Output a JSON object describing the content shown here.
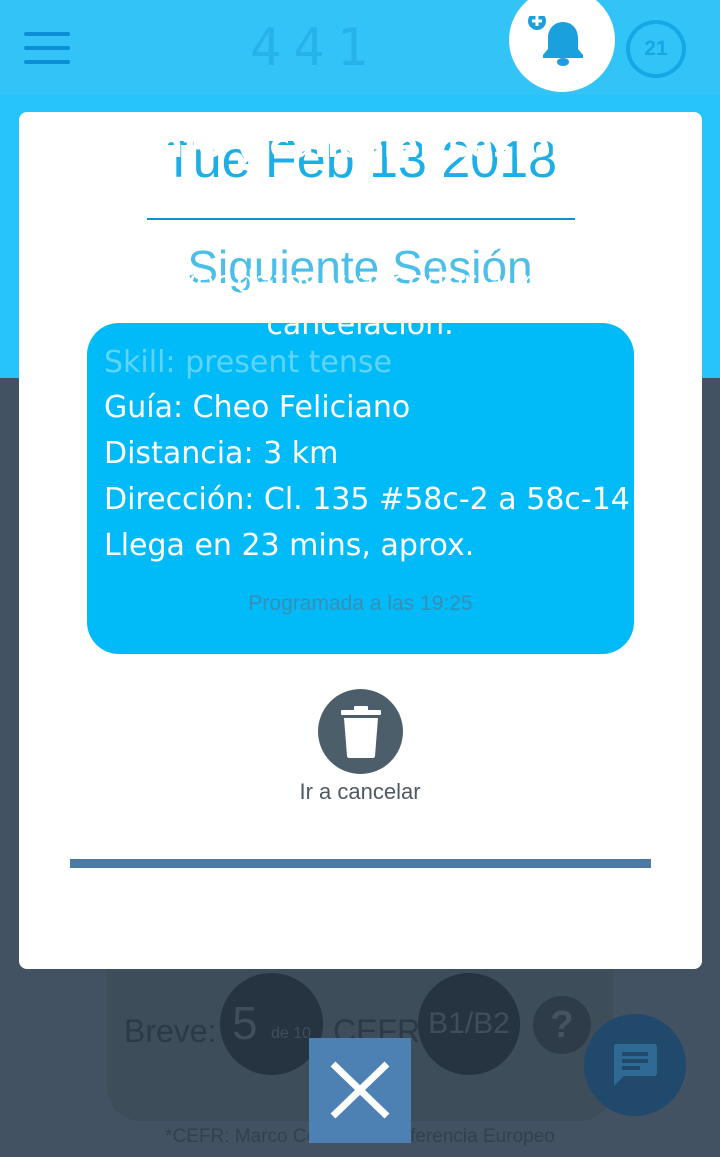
{
  "appbar": {
    "counter": "441",
    "level_badge": "21",
    "colors": {
      "bar": "#33c4f7",
      "icon": "#0a8fd6"
    },
    "icons": [
      "menu-icon",
      "bell-plus-icon"
    ]
  },
  "modal": {
    "date": "Tue Feb 13 2018",
    "next_heading": "Siguiente Sesión",
    "session": {
      "skill": "Skill: present tense",
      "guide": "Guía: Cheo Feliciano",
      "distance": "Distancia: 3 km",
      "address": "Dirección: Cl. 135 #58c-2 a 58c-14",
      "eta": "Llega en 23 mins, aprox."
    },
    "scheduled": "Programada a las 19:25",
    "cancel_label": "Ir a cancelar",
    "card_color": "#00bbf7"
  },
  "tooltip": {
    "title": "Info y cancelar sesión",
    "body": "Tocando en la campana de nueva sesión, podrás ver datos y acceder al menú de cancelación."
  },
  "background": {
    "breve_label": "Breve:",
    "score": "5",
    "score_of": "de 10",
    "cefr_label": "CEFR:",
    "level": "B1/B2",
    "help": "?",
    "footnote": "*CEFR: Marco Común de Referencia Europeo"
  }
}
